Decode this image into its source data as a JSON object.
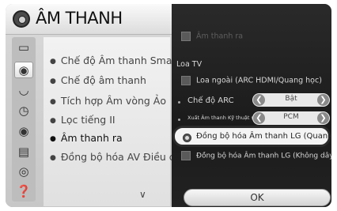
{
  "header": {
    "title": "ÂM THANH",
    "icon": "speaker-icon"
  },
  "side_icons": [
    "screen-icon",
    "speaker-icon",
    "clock-icon",
    "lock-icon",
    "options-icon",
    "network-icon",
    "support-icon"
  ],
  "menu": {
    "items": [
      "Chế độ Âm thanh Smart",
      "Chế độ âm thanh",
      "Tích hợp Âm vòng Ảo",
      "Lọc tiếng II",
      "Âm thanh ra",
      "Đồng bộ hóa AV Điều chỉnh"
    ],
    "selected_index": 4,
    "more_indicator": "chevron-down-icon"
  },
  "panel": {
    "tv_speaker_label": "Âm thanh ra",
    "section_label": "Loa TV",
    "external_speaker_label": "Loa ngoài (ARC HDMI/Quang học)",
    "arc_mode": {
      "label": "Chế độ ARC",
      "value": "Bật"
    },
    "digital_out": {
      "label": "Xuất Âm thanh Kỹ thuật số",
      "value": "PCM"
    },
    "lg_sync_optical": "Đồng bộ hóa Âm thanh LG (Quang)",
    "lg_sync_wireless": "Đồng bộ hóa Âm thanh LG (Không dây)",
    "ok_label": "OK"
  }
}
